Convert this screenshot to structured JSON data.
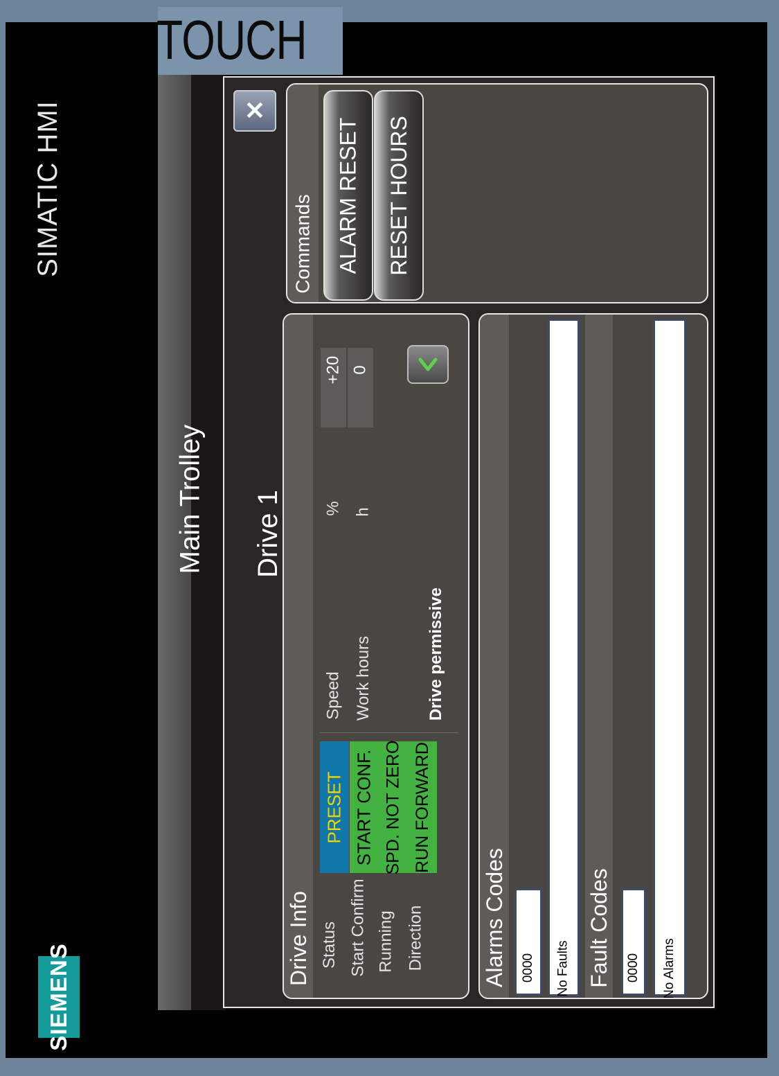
{
  "device": {
    "touch_label": "TOUCH",
    "hmi_label": "SIMATIC HMI",
    "brand": "SIEMENS"
  },
  "screen": {
    "title": "Main Trolley",
    "popup_title": "Drive 1",
    "close_label": "✕"
  },
  "commands": {
    "header": "Commands",
    "alarm_reset": "ALARM RESET",
    "reset_hours": "RESET HOURS"
  },
  "drive_info": {
    "header": "Drive Info",
    "rows": [
      {
        "label": "Status",
        "value": "PRESET",
        "bg": "#1176a8",
        "fg": "#f2d400"
      },
      {
        "label": "Start Confirm",
        "value": "START CONF.",
        "bg": "#44b241",
        "fg": "#000000"
      },
      {
        "label": "Running",
        "value": "SPD. NOT ZERO",
        "bg": "#44b241",
        "fg": "#000000"
      },
      {
        "label": "Direction",
        "value": "RUN FORWARD",
        "bg": "#44b241",
        "fg": "#000000"
      }
    ],
    "speed_label": "Speed",
    "speed_value": "+20",
    "speed_unit": "%",
    "hours_label": "Work hours",
    "hours_value": "0",
    "hours_unit": "h",
    "permissive_label": "Drive permissive",
    "permissive_icon": "check-icon",
    "permissive_color": "#5bd24b"
  },
  "codes": {
    "alarms_header": "Alarms Codes",
    "alarm_code": "0000",
    "alarm_text": "No Faults",
    "fault_header": "Fault Codes",
    "fault_code": "0000",
    "fault_text": "No Alarms"
  }
}
